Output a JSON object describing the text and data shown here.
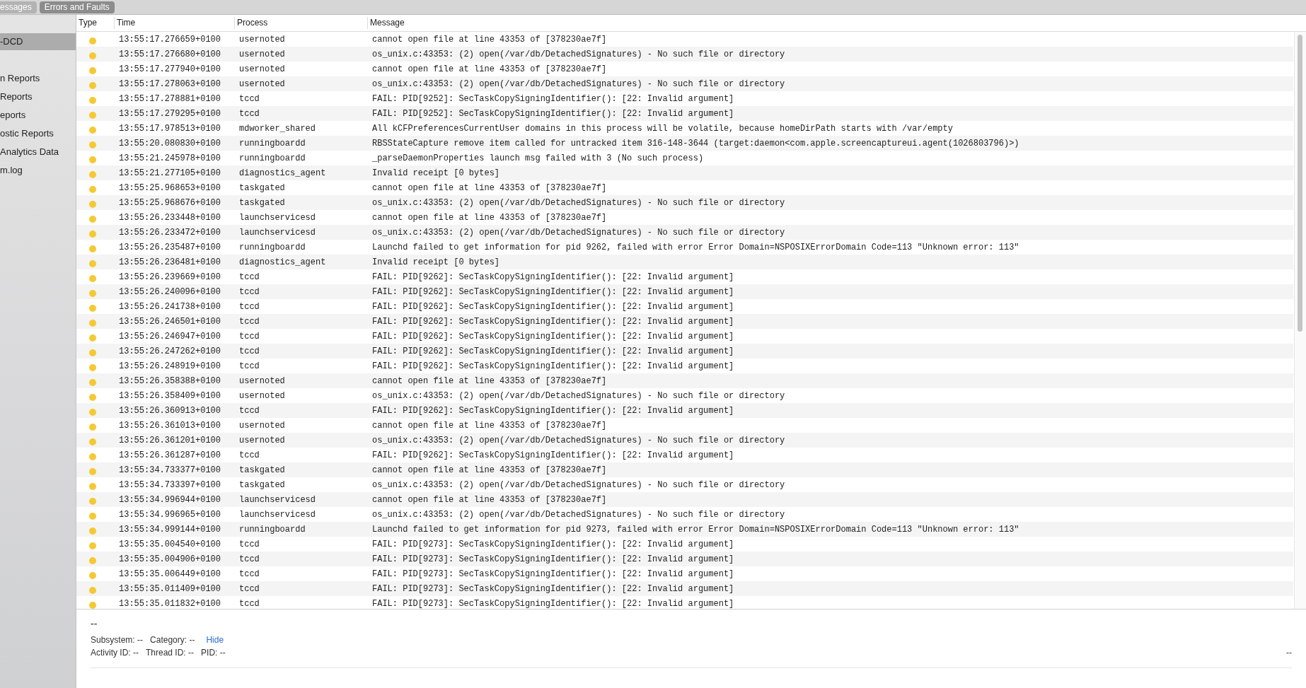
{
  "tabs": [
    {
      "label": "essages",
      "selected": false
    },
    {
      "label": "Errors and Faults",
      "selected": true
    }
  ],
  "sidebar": {
    "items": [
      {
        "label": "-DCD",
        "selected": true
      },
      {
        "label": "n Reports",
        "selected": false
      },
      {
        "label": "Reports",
        "selected": false
      },
      {
        "label": "eports",
        "selected": false
      },
      {
        "label": "ostic Reports",
        "selected": false
      },
      {
        "label": "Analytics Data",
        "selected": false
      },
      {
        "label": "m.log",
        "selected": false
      }
    ]
  },
  "table": {
    "columns": [
      "Type",
      "Time",
      "Process",
      "Message"
    ],
    "rows": [
      {
        "time": "13:55:17.276659+0100",
        "process": "usernoted",
        "message": "cannot open file at line 43353 of [378230ae7f]"
      },
      {
        "time": "13:55:17.276680+0100",
        "process": "usernoted",
        "message": "os_unix.c:43353: (2) open(/var/db/DetachedSignatures) - No such file or directory"
      },
      {
        "time": "13:55:17.277940+0100",
        "process": "usernoted",
        "message": "cannot open file at line 43353 of [378230ae7f]"
      },
      {
        "time": "13:55:17.278063+0100",
        "process": "usernoted",
        "message": "os_unix.c:43353: (2) open(/var/db/DetachedSignatures) - No such file or directory"
      },
      {
        "time": "13:55:17.278881+0100",
        "process": "tccd",
        "message": "FAIL: PID[9252]: SecTaskCopySigningIdentifier(): [22: Invalid argument]"
      },
      {
        "time": "13:55:17.279295+0100",
        "process": "tccd",
        "message": "FAIL: PID[9252]: SecTaskCopySigningIdentifier(): [22: Invalid argument]"
      },
      {
        "time": "13:55:17.978513+0100",
        "process": "mdworker_shared",
        "message": "All kCFPreferencesCurrentUser domains in this process will be volatile, because homeDirPath starts with /var/empty"
      },
      {
        "time": "13:55:20.080830+0100",
        "process": "runningboardd",
        "message": "RBSStateCapture remove item called for untracked item 316-148-3644 (target:daemon<com.apple.screencaptureui.agent(1026803796)>)"
      },
      {
        "time": "13:55:21.245978+0100",
        "process": "runningboardd",
        "message": "_parseDaemonProperties launch msg failed with 3 (No such process)"
      },
      {
        "time": "13:55:21.277105+0100",
        "process": "diagnostics_agent",
        "message": "Invalid receipt [0 bytes]"
      },
      {
        "time": "13:55:25.968653+0100",
        "process": "taskgated",
        "message": "cannot open file at line 43353 of [378230ae7f]"
      },
      {
        "time": "13:55:25.968676+0100",
        "process": "taskgated",
        "message": "os_unix.c:43353: (2) open(/var/db/DetachedSignatures) - No such file or directory"
      },
      {
        "time": "13:55:26.233448+0100",
        "process": "launchservicesd",
        "message": "cannot open file at line 43353 of [378230ae7f]"
      },
      {
        "time": "13:55:26.233472+0100",
        "process": "launchservicesd",
        "message": "os_unix.c:43353: (2) open(/var/db/DetachedSignatures) - No such file or directory"
      },
      {
        "time": "13:55:26.235487+0100",
        "process": "runningboardd",
        "message": "Launchd failed to get information for pid 9262, failed with error Error Domain=NSPOSIXErrorDomain Code=113 \"Unknown error: 113\""
      },
      {
        "time": "13:55:26.236481+0100",
        "process": "diagnostics_agent",
        "message": "Invalid receipt [0 bytes]"
      },
      {
        "time": "13:55:26.239669+0100",
        "process": "tccd",
        "message": "FAIL: PID[9262]: SecTaskCopySigningIdentifier(): [22: Invalid argument]"
      },
      {
        "time": "13:55:26.240096+0100",
        "process": "tccd",
        "message": "FAIL: PID[9262]: SecTaskCopySigningIdentifier(): [22: Invalid argument]"
      },
      {
        "time": "13:55:26.241738+0100",
        "process": "tccd",
        "message": "FAIL: PID[9262]: SecTaskCopySigningIdentifier(): [22: Invalid argument]"
      },
      {
        "time": "13:55:26.246501+0100",
        "process": "tccd",
        "message": "FAIL: PID[9262]: SecTaskCopySigningIdentifier(): [22: Invalid argument]"
      },
      {
        "time": "13:55:26.246947+0100",
        "process": "tccd",
        "message": "FAIL: PID[9262]: SecTaskCopySigningIdentifier(): [22: Invalid argument]"
      },
      {
        "time": "13:55:26.247262+0100",
        "process": "tccd",
        "message": "FAIL: PID[9262]: SecTaskCopySigningIdentifier(): [22: Invalid argument]"
      },
      {
        "time": "13:55:26.248919+0100",
        "process": "tccd",
        "message": "FAIL: PID[9262]: SecTaskCopySigningIdentifier(): [22: Invalid argument]"
      },
      {
        "time": "13:55:26.358388+0100",
        "process": "usernoted",
        "message": "cannot open file at line 43353 of [378230ae7f]"
      },
      {
        "time": "13:55:26.358409+0100",
        "process": "usernoted",
        "message": "os_unix.c:43353: (2) open(/var/db/DetachedSignatures) - No such file or directory"
      },
      {
        "time": "13:55:26.360913+0100",
        "process": "tccd",
        "message": "FAIL: PID[9262]: SecTaskCopySigningIdentifier(): [22: Invalid argument]"
      },
      {
        "time": "13:55:26.361013+0100",
        "process": "usernoted",
        "message": "cannot open file at line 43353 of [378230ae7f]"
      },
      {
        "time": "13:55:26.361201+0100",
        "process": "usernoted",
        "message": "os_unix.c:43353: (2) open(/var/db/DetachedSignatures) - No such file or directory"
      },
      {
        "time": "13:55:26.361287+0100",
        "process": "tccd",
        "message": "FAIL: PID[9262]: SecTaskCopySigningIdentifier(): [22: Invalid argument]"
      },
      {
        "time": "13:55:34.733377+0100",
        "process": "taskgated",
        "message": "cannot open file at line 43353 of [378230ae7f]"
      },
      {
        "time": "13:55:34.733397+0100",
        "process": "taskgated",
        "message": "os_unix.c:43353: (2) open(/var/db/DetachedSignatures) - No such file or directory"
      },
      {
        "time": "13:55:34.996944+0100",
        "process": "launchservicesd",
        "message": "cannot open file at line 43353 of [378230ae7f]"
      },
      {
        "time": "13:55:34.996965+0100",
        "process": "launchservicesd",
        "message": "os_unix.c:43353: (2) open(/var/db/DetachedSignatures) - No such file or directory"
      },
      {
        "time": "13:55:34.999144+0100",
        "process": "runningboardd",
        "message": "Launchd failed to get information for pid 9273, failed with error Error Domain=NSPOSIXErrorDomain Code=113 \"Unknown error: 113\""
      },
      {
        "time": "13:55:35.004540+0100",
        "process": "tccd",
        "message": "FAIL: PID[9273]: SecTaskCopySigningIdentifier(): [22: Invalid argument]"
      },
      {
        "time": "13:55:35.004906+0100",
        "process": "tccd",
        "message": "FAIL: PID[9273]: SecTaskCopySigningIdentifier(): [22: Invalid argument]"
      },
      {
        "time": "13:55:35.006449+0100",
        "process": "tccd",
        "message": "FAIL: PID[9273]: SecTaskCopySigningIdentifier(): [22: Invalid argument]"
      },
      {
        "time": "13:55:35.011409+0100",
        "process": "tccd",
        "message": "FAIL: PID[9273]: SecTaskCopySigningIdentifier(): [22: Invalid argument]"
      },
      {
        "time": "13:55:35.011832+0100",
        "process": "tccd",
        "message": "FAIL: PID[9273]: SecTaskCopySigningIdentifier(): [22: Invalid argument]"
      }
    ]
  },
  "detail": {
    "title": "--",
    "fields": [
      [
        {
          "label": "Subsystem:",
          "value": "--"
        },
        {
          "label": "Category:",
          "value": "--"
        }
      ],
      [
        {
          "label": "Activity ID:",
          "value": "--"
        },
        {
          "label": "Thread ID:",
          "value": "--"
        },
        {
          "label": "PID:",
          "value": "--"
        }
      ]
    ],
    "link": "Hide",
    "right_value": "--"
  }
}
